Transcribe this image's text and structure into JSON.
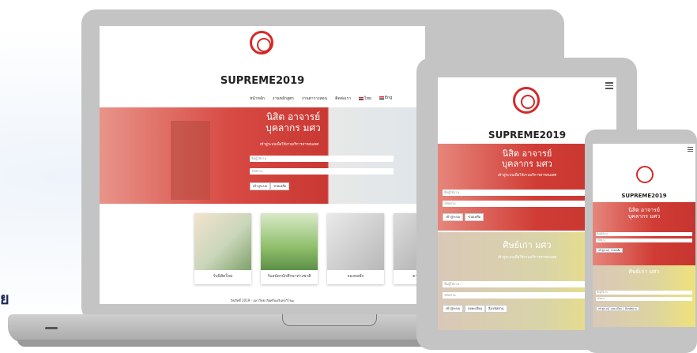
{
  "side_text": "ย",
  "site": {
    "title": "SUPREME2019",
    "nav": [
      "หน้าหลัก",
      "งานหลักสูตร",
      "งานตารางสอน",
      "ติดต่อเรา",
      "ไทย",
      "Eng"
    ],
    "hero1": {
      "heading_line1": "นิสิต อาจารย์",
      "heading_line2": "บุคลากร มศว",
      "subtitle": "เข้าสู่ระบบเพื่อใช้งานบริการสารสนเทศ",
      "username_placeholder": "ชื่อผู้ใช้งาน",
      "password_placeholder": "รหัสผ่าน",
      "login_label": "เข้าสู่ระบบ",
      "forgot_label": "ช่วยเหลือ"
    },
    "hero2": {
      "heading": "ศิษย์เก่า มศว",
      "subtitle": "เข้าสู่ระบบเพื่อใช้งานบริการสารสนเทศ",
      "username_placeholder": "ชื่อผู้ใช้งาน",
      "password_placeholder": "รหัสผ่าน",
      "login_label": "เข้าสู่ระบบ",
      "register_label": "ลงทะเบียน",
      "forgot_label": "ลืมรหัสผ่าน"
    },
    "cards": [
      "รับนิสิตใหม่",
      "รับสมัครนักศึกษาต่างชาติ",
      "จองหอพัก",
      "ตารางสอน"
    ],
    "footer": "ลิขสิทธิ์ 2019 - มหาวิทยาลัยศรีนครินทรวิโรฒ"
  },
  "colors": {
    "brand_red": "#d42a2a",
    "device_gray": "#c4c4c4",
    "title_dark": "#222222"
  }
}
